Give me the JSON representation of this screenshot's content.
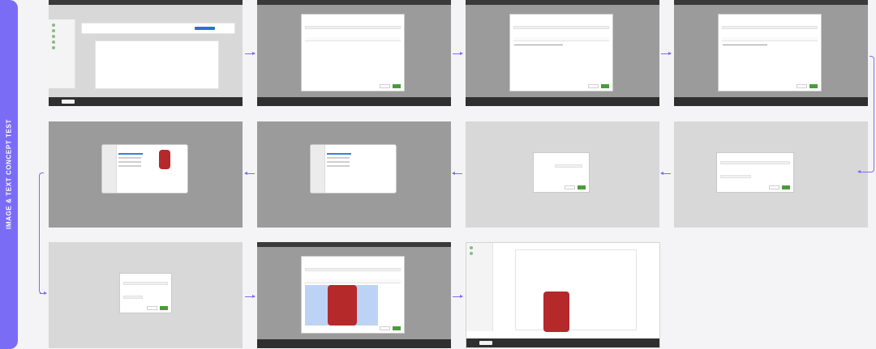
{
  "side_label": "IMAGE & TEXT CONCEPT TEST",
  "screens": [
    {
      "id": "s1",
      "kind": "product-page"
    },
    {
      "id": "s2",
      "kind": "stimulus-modal-empty"
    },
    {
      "id": "s3",
      "kind": "stimulus-modal-text"
    },
    {
      "id": "s4",
      "kind": "stimulus-modal-toolbar"
    },
    {
      "id": "s5",
      "kind": "file-picker-selected"
    },
    {
      "id": "s6",
      "kind": "file-picker"
    },
    {
      "id": "s7",
      "kind": "insert-image-dialog"
    },
    {
      "id": "s8",
      "kind": "insert-image-options"
    },
    {
      "id": "s9",
      "kind": "insert-image-dialog-filled"
    },
    {
      "id": "s10",
      "kind": "stimulus-modal-image-selected"
    },
    {
      "id": "s11",
      "kind": "final-concept-page"
    }
  ],
  "colors": {
    "accent": "#7b6cf6",
    "green": "#4b9a3c",
    "blue": "#2b6fd6",
    "product_red": "#b5292b"
  }
}
